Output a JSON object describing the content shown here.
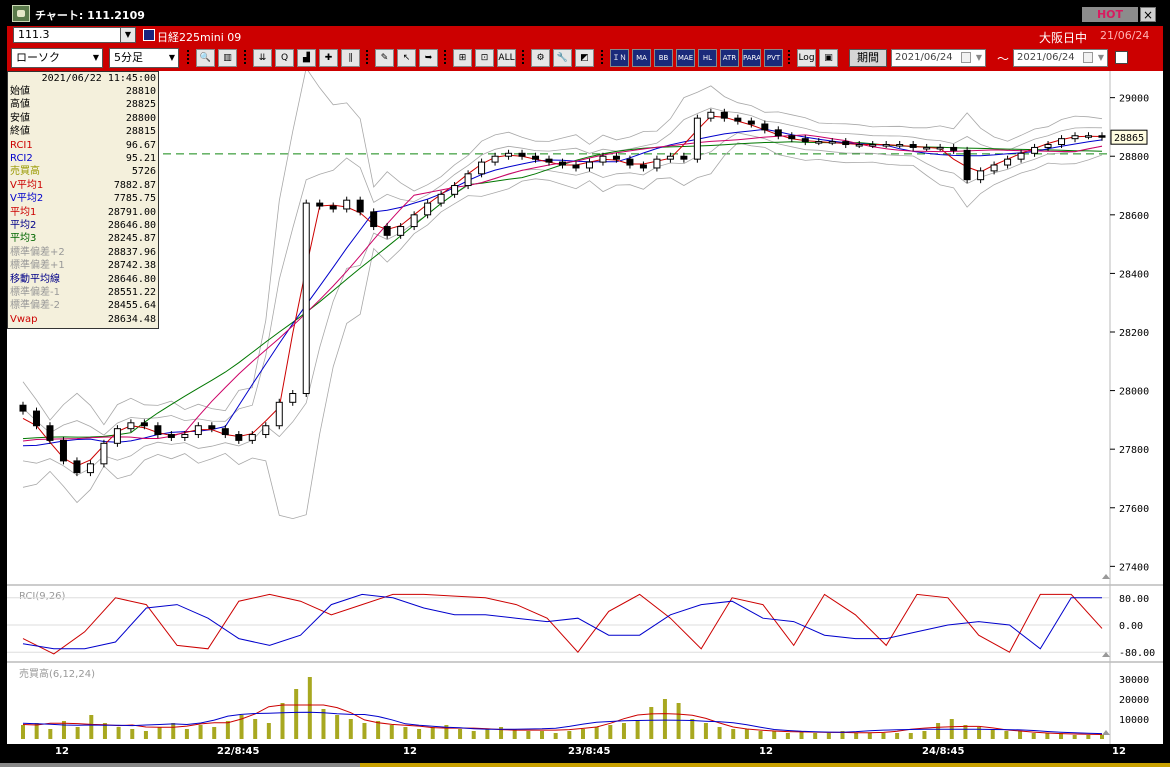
{
  "window": {
    "title": "チャート: 111.2109",
    "hot_label": "HOT",
    "close_label": "×"
  },
  "header": {
    "symbol_code": "111.3",
    "symbol_name": "日経225mini 09",
    "market_status": "大阪日中",
    "date": "21/06/24"
  },
  "toolbar": {
    "chart_type": "ローソク",
    "interval": "5分足",
    "buttons": [
      {
        "icon": "zoom-icon",
        "label": "🔍"
      },
      {
        "icon": "split-icon",
        "label": "▥"
      },
      {
        "icon": "scroll-down-icon",
        "label": "⇊"
      },
      {
        "icon": "search-icon",
        "label": "Q"
      },
      {
        "icon": "bar-chart-icon",
        "label": "▟"
      },
      {
        "icon": "cross-icon",
        "label": "✚"
      },
      {
        "icon": "pause-icon",
        "label": "∥"
      },
      {
        "icon": "pencil-icon",
        "label": "✎"
      },
      {
        "icon": "cursor-icon",
        "label": "↖"
      },
      {
        "icon": "arrow-icon",
        "label": "➥"
      },
      {
        "icon": "candle-icon",
        "label": "⊞"
      },
      {
        "icon": "candle2-icon",
        "label": "⊡"
      },
      {
        "icon": "all-icon",
        "label": "ALL"
      },
      {
        "icon": "settings-icon",
        "label": "⚙"
      },
      {
        "icon": "wrench-icon",
        "label": "🔧"
      },
      {
        "icon": "palette-icon",
        "label": "◩"
      },
      {
        "icon": "indicator-icon",
        "label": "ＩＮＤ"
      },
      {
        "icon": "ma-icon",
        "label": "MA"
      },
      {
        "icon": "bb-icon",
        "label": "BB"
      },
      {
        "icon": "mae-icon",
        "label": "MAE"
      },
      {
        "icon": "hl-icon",
        "label": "HL"
      },
      {
        "icon": "atr-icon",
        "label": "ATR"
      },
      {
        "icon": "para-icon",
        "label": "PARA"
      },
      {
        "icon": "pvt-icon",
        "label": "PVT"
      },
      {
        "icon": "log-icon",
        "label": "Log"
      },
      {
        "icon": "export-icon",
        "label": "▣"
      }
    ],
    "period_label": "期間",
    "date_from": "2021/06/24",
    "date_to": "2021/06/24",
    "tilde": "～"
  },
  "data_window": {
    "datetime": "2021/06/22  11:45:00",
    "rows": [
      {
        "label": "始値",
        "value": "28810",
        "color": "#000000"
      },
      {
        "label": "高値",
        "value": "28825",
        "color": "#000000"
      },
      {
        "label": "安値",
        "value": "28800",
        "color": "#000000"
      },
      {
        "label": "終値",
        "value": "28815",
        "color": "#000000"
      },
      {
        "label": "RCI1",
        "value": "96.67",
        "color": "#cc0000"
      },
      {
        "label": "RCI2",
        "value": "95.21",
        "color": "#0000cc"
      },
      {
        "label": "売買高",
        "value": "5726",
        "color": "#999900"
      },
      {
        "label": "V平均1",
        "value": "7882.87",
        "color": "#cc0000"
      },
      {
        "label": "V平均2",
        "value": "7785.75",
        "color": "#0000cc"
      },
      {
        "label": "平均1",
        "value": "28791.00",
        "color": "#cc0000"
      },
      {
        "label": "平均2",
        "value": "28646.80",
        "color": "#000088"
      },
      {
        "label": "平均3",
        "value": "28245.87",
        "color": "#006600"
      },
      {
        "label": "標準偏差+2",
        "value": "28837.96",
        "color": "#999999"
      },
      {
        "label": "標準偏差+1",
        "value": "28742.38",
        "color": "#999999"
      },
      {
        "label": "移動平均線",
        "value": "28646.80",
        "color": "#000088"
      },
      {
        "label": "標準偏差-1",
        "value": "28551.22",
        "color": "#999999"
      },
      {
        "label": "標準偏差-2",
        "value": "28455.64",
        "color": "#999999"
      },
      {
        "label": "Vwap",
        "value": "28634.48",
        "color": "#cc0000"
      }
    ]
  },
  "price_axis": {
    "ticks": [
      "29000",
      "28800",
      "28600",
      "28400",
      "28200",
      "28000",
      "27800",
      "27600",
      "27400"
    ],
    "current_price": "28865",
    "reference_line": 28808
  },
  "rci_panel": {
    "label": "RCI(9,26)",
    "ticks": [
      "80.00",
      "0.00",
      "-80.00"
    ]
  },
  "volume_panel": {
    "label": "売買高(6,12,24)",
    "ticks": [
      "30000",
      "20000",
      "10000"
    ]
  },
  "x_axis": {
    "labels": [
      "12",
      "22/8:45",
      "12",
      "23/8:45",
      "12",
      "24/8:45",
      "12"
    ]
  },
  "colors": {
    "frame_red": "#cc0000",
    "ma_fast": "#cc0000",
    "ma_mid": "#0000cc",
    "ma_slow": "#007700",
    "vwap": "#cc0066",
    "band": "#a8a8a8",
    "volume": "#a8a820"
  },
  "chart_data": [
    {
      "type": "candlestick",
      "title": "",
      "ylim": [
        27350,
        29050
      ],
      "series": [
        {
          "name": "終値",
          "values": [
            27930,
            27880,
            27830,
            27760,
            27720,
            27750,
            27820,
            27870,
            27890,
            27880,
            27850,
            27840,
            27850,
            27880,
            27870,
            27850,
            27830,
            27850,
            27880,
            27960,
            27990,
            28640,
            28630,
            28620,
            28650,
            28610,
            28560,
            28530,
            28560,
            28600,
            28640,
            28670,
            28700,
            28740,
            28780,
            28800,
            28810,
            28800,
            28790,
            28780,
            28770,
            28760,
            28780,
            28800,
            28790,
            28770,
            28760,
            28790,
            28800,
            28790,
            28930,
            28950,
            28930,
            28920,
            28910,
            28890,
            28870,
            28860,
            28850,
            28850,
            28850,
            28840,
            28840,
            28840,
            28840,
            28840,
            28830,
            28830,
            28830,
            28820,
            28720,
            28750,
            28770,
            28790,
            28810,
            28830,
            28840,
            28860,
            28870,
            28870,
            28865
          ]
        }
      ]
    },
    {
      "type": "line",
      "title": "RCI(9,26)",
      "ylim": [
        -100,
        100
      ],
      "series": [
        {
          "name": "RCI1",
          "values": [
            -40,
            -85,
            -20,
            80,
            60,
            -60,
            -70,
            70,
            90,
            70,
            30,
            60,
            90,
            90,
            85,
            80,
            60,
            20,
            -80,
            40,
            90,
            20,
            -70,
            80,
            60,
            -60,
            90,
            30,
            -60,
            90,
            80,
            -30,
            -80,
            90,
            90,
            -10
          ]
        },
        {
          "name": "RCI2",
          "values": [
            -55,
            -70,
            -70,
            -50,
            50,
            60,
            20,
            -40,
            -60,
            -30,
            60,
            90,
            80,
            50,
            30,
            30,
            20,
            10,
            20,
            -30,
            -30,
            30,
            60,
            70,
            20,
            10,
            -30,
            -40,
            -40,
            -20,
            0,
            10,
            0,
            -70,
            80,
            80
          ]
        }
      ]
    },
    {
      "type": "bar",
      "title": "売買高(6,12,24)",
      "ylim": [
        0,
        35000
      ],
      "series": [
        {
          "name": "売買高",
          "values": [
            7000,
            8000,
            5000,
            9000,
            6000,
            12000,
            8000,
            6000,
            5000,
            4000,
            6000,
            8000,
            5000,
            7000,
            6000,
            9000,
            12000,
            10000,
            8000,
            18000,
            25000,
            31000,
            15000,
            12000,
            10000,
            8000,
            9000,
            7000,
            6000,
            5000,
            6000,
            7000,
            5000,
            4000,
            5000,
            6000,
            5000,
            4000,
            4000,
            3000,
            4000,
            5000,
            6000,
            7000,
            8000,
            9000,
            16000,
            20000,
            18000,
            10000,
            8000,
            6000,
            5000,
            5000,
            4000,
            4000,
            3000,
            4000,
            3000,
            3000,
            4000,
            3000,
            3000,
            3000,
            3000,
            3000,
            4000,
            8000,
            10000,
            7000,
            6000,
            5000,
            4000,
            4000,
            3000,
            3000,
            3000,
            2000,
            2000,
            2000
          ]
        }
      ]
    }
  ]
}
